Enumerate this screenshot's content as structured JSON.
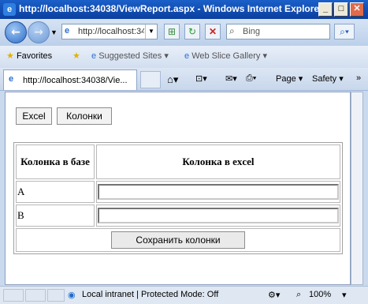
{
  "window": {
    "title": "http://localhost:34038/ViewReport.aspx - Windows Internet Explorer",
    "title_icon": "ie-logo"
  },
  "address": {
    "url": "http://localhost:34038/ViewReport.aspx",
    "search_placeholder": "Bing"
  },
  "favorites": {
    "label": "Favorites",
    "items": [
      "Suggested Sites ▾",
      "Web Slice Gallery ▾"
    ]
  },
  "tab": {
    "title": "http://localhost:34038/Vie..."
  },
  "commands": {
    "page": "Page ▾",
    "safety": "Safety ▾",
    "more": "»"
  },
  "page": {
    "buttons": [
      "Excel",
      "Колонки"
    ],
    "table": {
      "headers": [
        "Колонка в базе",
        "Колонка в excel"
      ],
      "rows": [
        {
          "name": "A",
          "value": ""
        },
        {
          "name": "B",
          "value": ""
        }
      ],
      "save_label": "Сохранить колонки"
    }
  },
  "status": {
    "zone": "Local intranet | Protected Mode: Off",
    "zoom": "100%"
  }
}
